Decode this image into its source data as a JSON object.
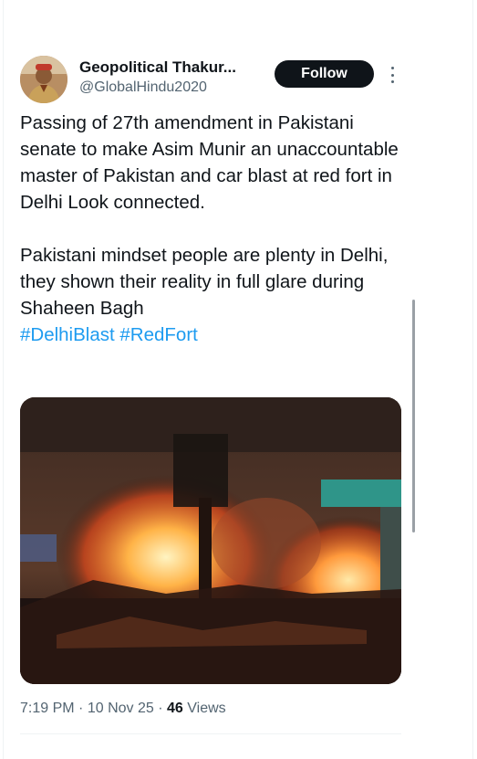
{
  "author": {
    "display_name": "Geopolitical Thakur...",
    "handle": "@GlobalHindu2020"
  },
  "follow_label": "Follow",
  "tweet": {
    "line1": "Passing of 27th amendment in Pakistani senate to make Asim Munir an unaccountable master of Pakistan and car blast at red fort in Delhi Look connected.",
    "line2": "Pakistani mindset people are plenty in Delhi, they shown their reality in full glare during Shaheen Bagh",
    "hashtags": [
      "#DelhiBlast",
      "#RedFort"
    ]
  },
  "meta": {
    "time": "7:19 PM",
    "date": "10 Nov 25",
    "views_count": "46",
    "views_label": "Views"
  },
  "icons": {
    "more": "more-vertical-icon"
  },
  "colors": {
    "accent": "#1d9bf0",
    "button_bg": "#0f1419",
    "secondary_text": "#536471"
  }
}
